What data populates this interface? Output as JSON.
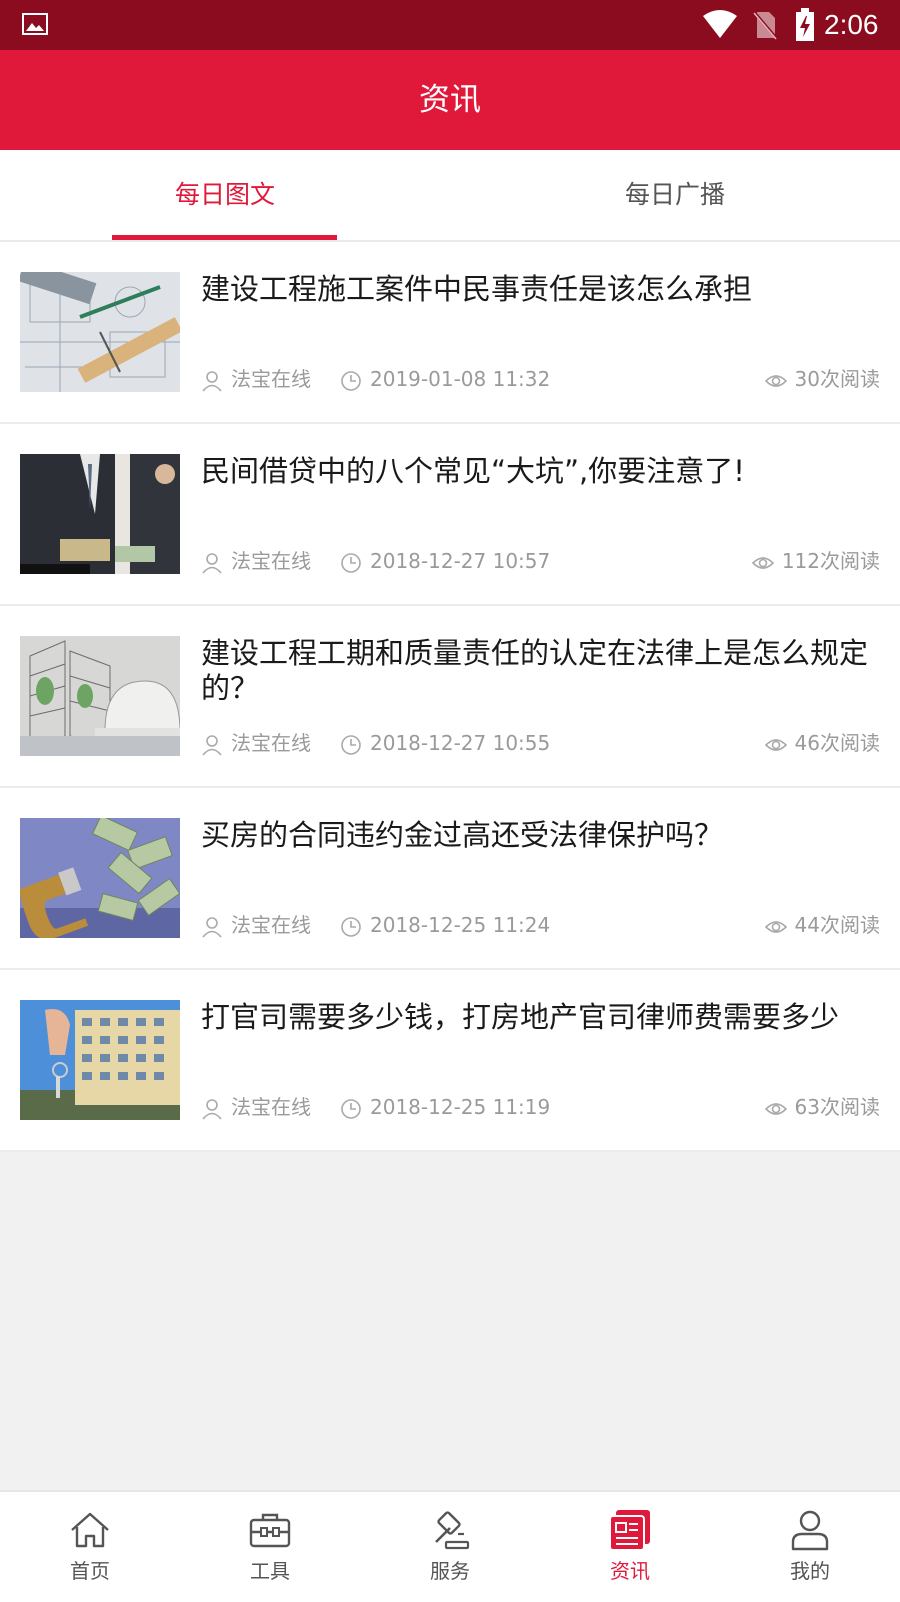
{
  "status_bar": {
    "time": "2:06"
  },
  "header": {
    "title": "资讯"
  },
  "tabs": [
    {
      "label": "每日图文",
      "active": true
    },
    {
      "label": "每日广播",
      "active": false
    }
  ],
  "articles": [
    {
      "title": "建设工程施工案件中民事责任是该怎么承担",
      "author": "法宝在线",
      "time": "2019-01-08 11:32",
      "views": "30次阅读",
      "thumbnail": "blueprint-ruler"
    },
    {
      "title": "民间借贷中的八个常见“大坑”,你要注意了!",
      "author": "法宝在线",
      "time": "2018-12-27 10:57",
      "views": "112次阅读",
      "thumbnail": "money-handover"
    },
    {
      "title": "建设工程工期和质量责任的认定在法律上是怎么规定的？",
      "author": "法宝在线",
      "time": "2018-12-27 10:55",
      "views": "46次阅读",
      "thumbnail": "helmet-buildings"
    },
    {
      "title": "买房的合同违约金过高还受法律保护吗？",
      "author": "法宝在线",
      "time": "2018-12-25 11:24",
      "views": "44次阅读",
      "thumbnail": "magnet-money"
    },
    {
      "title": "打官司需要多少钱，打房地产官司律师费需要多少",
      "author": "法宝在线",
      "time": "2018-12-25 11:19",
      "views": "63次阅读",
      "thumbnail": "keys-building"
    }
  ],
  "bottom_nav": [
    {
      "label": "首页",
      "icon": "home-icon",
      "active": false
    },
    {
      "label": "工具",
      "icon": "toolbox-icon",
      "active": false
    },
    {
      "label": "服务",
      "icon": "gavel-icon",
      "active": false
    },
    {
      "label": "资讯",
      "icon": "news-icon",
      "active": true
    },
    {
      "label": "我的",
      "icon": "user-icon",
      "active": false
    }
  ],
  "colors": {
    "accent": "#e0193a",
    "status_bar": "#8c0c1f",
    "background": "#f1f1f1"
  }
}
